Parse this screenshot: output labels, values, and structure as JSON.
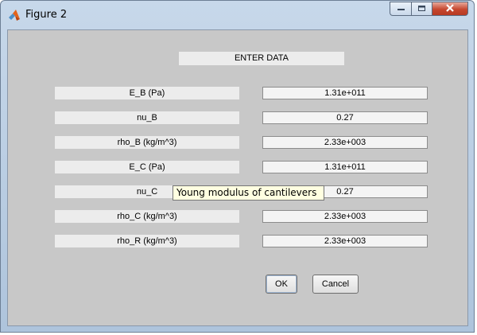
{
  "window": {
    "title": "Figure 2",
    "icon": "matlab-icon",
    "controls": {
      "minimize": "minimize-icon",
      "maximize": "maximize-icon",
      "close": "close-icon"
    }
  },
  "form": {
    "header": "ENTER DATA",
    "rows": [
      {
        "label": "E_B (Pa)",
        "value": "1.31e+011"
      },
      {
        "label": "nu_B",
        "value": "0.27"
      },
      {
        "label": "rho_B (kg/m^3)",
        "value": "2.33e+003"
      },
      {
        "label": "E_C (Pa)",
        "value": "1.31e+011"
      },
      {
        "label": "nu_C",
        "value": "0.27"
      },
      {
        "label": "rho_C (kg/m^3)",
        "value": "2.33e+003"
      },
      {
        "label": "rho_R (kg/m^3)",
        "value": "2.33e+003"
      }
    ],
    "ok_label": "OK",
    "cancel_label": "Cancel"
  },
  "tooltip": {
    "text": "Young modulus of cantilevers"
  },
  "colors": {
    "titlebar": "#b9cde3",
    "client_background": "#c8c8c8",
    "label_background": "#ececec",
    "tooltip_background": "#ffffe1",
    "close_button": "#c6472f"
  }
}
